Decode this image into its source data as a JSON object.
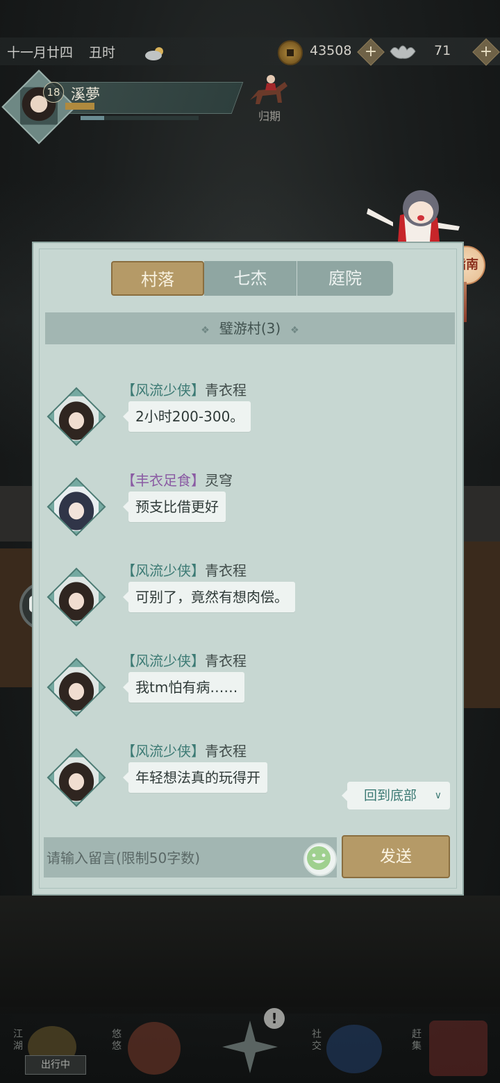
{
  "status_bar": {
    "date": "十一月廿四",
    "time": "丑时",
    "weather_icon": "cloudy-sun-icon",
    "coins": "43508",
    "ingots": "71"
  },
  "player": {
    "level": "18",
    "name": "溪夢",
    "exp_fraction": 0.15,
    "stamina_fraction": 0.2,
    "return_label": "归期"
  },
  "guide": {
    "label": "指南"
  },
  "tabs": [
    {
      "label": "村落",
      "active": true
    },
    {
      "label": "七杰",
      "active": false
    },
    {
      "label": "庭院",
      "active": false
    }
  ],
  "channel": {
    "title": "璧游村(3)"
  },
  "messages": [
    {
      "title": "【风流少侠】",
      "name": "青衣程",
      "text": "2小时200-300。"
    },
    {
      "title": "【丰衣足食】",
      "name": "灵穹",
      "text": "预支比借更好"
    },
    {
      "title": "【风流少侠】",
      "name": "青衣程",
      "text": "可别了，竟然有想肉偿。"
    },
    {
      "title": "【风流少侠】",
      "name": "青衣程",
      "text": "我tm怕有病……"
    },
    {
      "title": "【风流少侠】",
      "name": "青衣程",
      "text": "年轻想法真的玩得开"
    }
  ],
  "back_to_bottom": "回到底部",
  "input": {
    "placeholder": "请输入留言(限制50字数)",
    "value": ""
  },
  "send_label": "发送",
  "bottom_nav": {
    "jianghu": "江湖",
    "traveling": "出行中",
    "youyou": "悠悠",
    "social": "社交",
    "market": "赶集"
  },
  "colors": {
    "panel": "#c7d7d2",
    "accent_gold": "#b59a67",
    "title_teal": "#3c7a74",
    "title_purple": "#8a5aa3"
  }
}
